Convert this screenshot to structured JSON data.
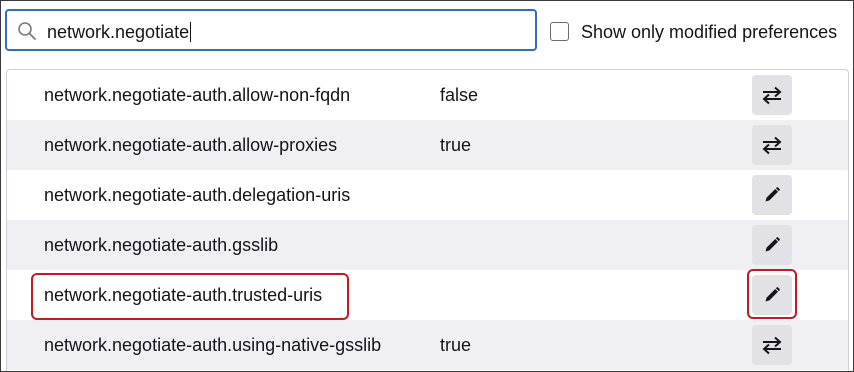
{
  "search": {
    "value": "network.negotiate",
    "icon": "search-icon"
  },
  "filter": {
    "label": "Show only modified preferences",
    "checked": false
  },
  "colors": {
    "accent": "#2f6fbf",
    "highlight": "#c8191f",
    "row_alt": "#f0f0f4",
    "button_bg": "#e2e2e6"
  },
  "preferences": [
    {
      "name": "network.negotiate-auth.allow-non-fqdn",
      "value": "false",
      "action": "toggle-icon"
    },
    {
      "name": "network.negotiate-auth.allow-proxies",
      "value": "true",
      "action": "toggle-icon"
    },
    {
      "name": "network.negotiate-auth.delegation-uris",
      "value": "",
      "action": "edit-icon"
    },
    {
      "name": "network.negotiate-auth.gsslib",
      "value": "",
      "action": "edit-icon"
    },
    {
      "name": "network.negotiate-auth.trusted-uris",
      "value": "",
      "action": "edit-icon"
    },
    {
      "name": "network.negotiate-auth.using-native-gsslib",
      "value": "true",
      "action": "toggle-icon"
    }
  ]
}
